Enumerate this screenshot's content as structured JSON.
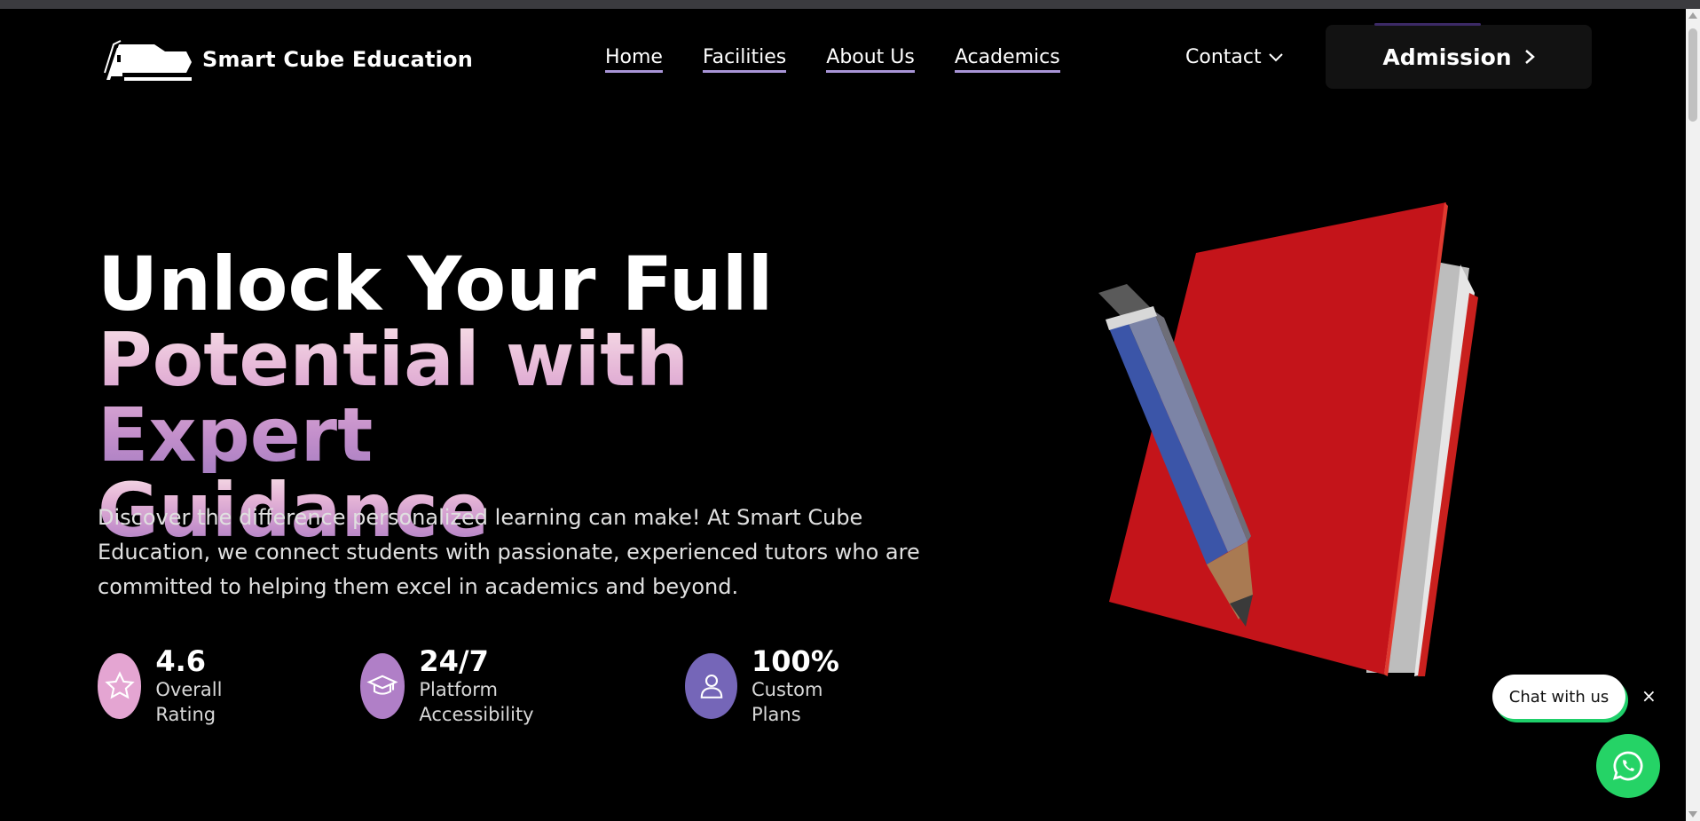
{
  "header": {
    "brand": "Smart Cube Education",
    "nav": [
      {
        "label": "Home"
      },
      {
        "label": "Facilities"
      },
      {
        "label": "About Us"
      },
      {
        "label": "Academics"
      }
    ],
    "contact_label": "Contact",
    "admission_label": "Admission"
  },
  "hero": {
    "title_line1": "Unlock Your Full",
    "title_line2": "Potential with Expert",
    "title_line3": "Guidance",
    "description": "Discover the difference personalized learning can make! At Smart Cube Education, we connect students with passionate, experienced tutors who are committed to helping them excel in academics and beyond.",
    "stats": [
      {
        "value": "4.6",
        "label": "Overall Rating",
        "icon": "star-icon",
        "color": "#e4a5d2"
      },
      {
        "value": "24/7",
        "label": "Platform Accessibility",
        "icon": "graduation-cap-icon",
        "color": "#b07fc7"
      },
      {
        "value": "100%",
        "label": "Custom Plans",
        "icon": "user-icon",
        "color": "#7566b8"
      }
    ]
  },
  "chat": {
    "bubble_label": "Chat with us",
    "close_label": "×"
  },
  "colors": {
    "background": "#000000",
    "nav_underline": "#a995d8",
    "whatsapp": "#25d366",
    "book": "#c4141a"
  }
}
